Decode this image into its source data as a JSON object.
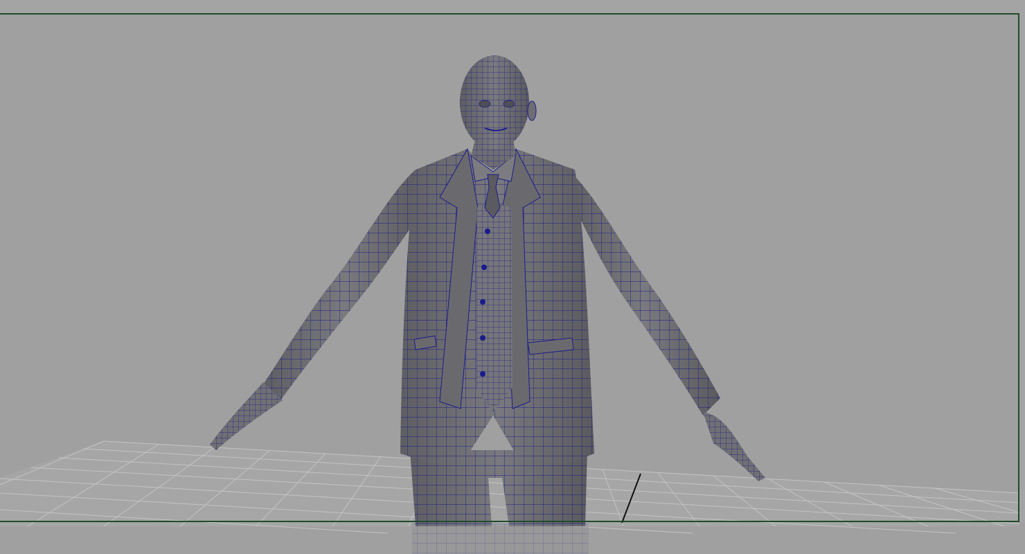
{
  "viewport": {
    "background_color": "#a0a0a0",
    "gate_color": "#1f4a2c",
    "grid_color": "#c6c6c6",
    "wireframe_color": "#1a1a8c",
    "shading_color": "#6e6e6e",
    "display_mode": "wireframe-on-shaded"
  },
  "scene": {
    "model": "suited-man-t-pose",
    "grid": "ground-grid",
    "axis": "world-axis-line"
  }
}
